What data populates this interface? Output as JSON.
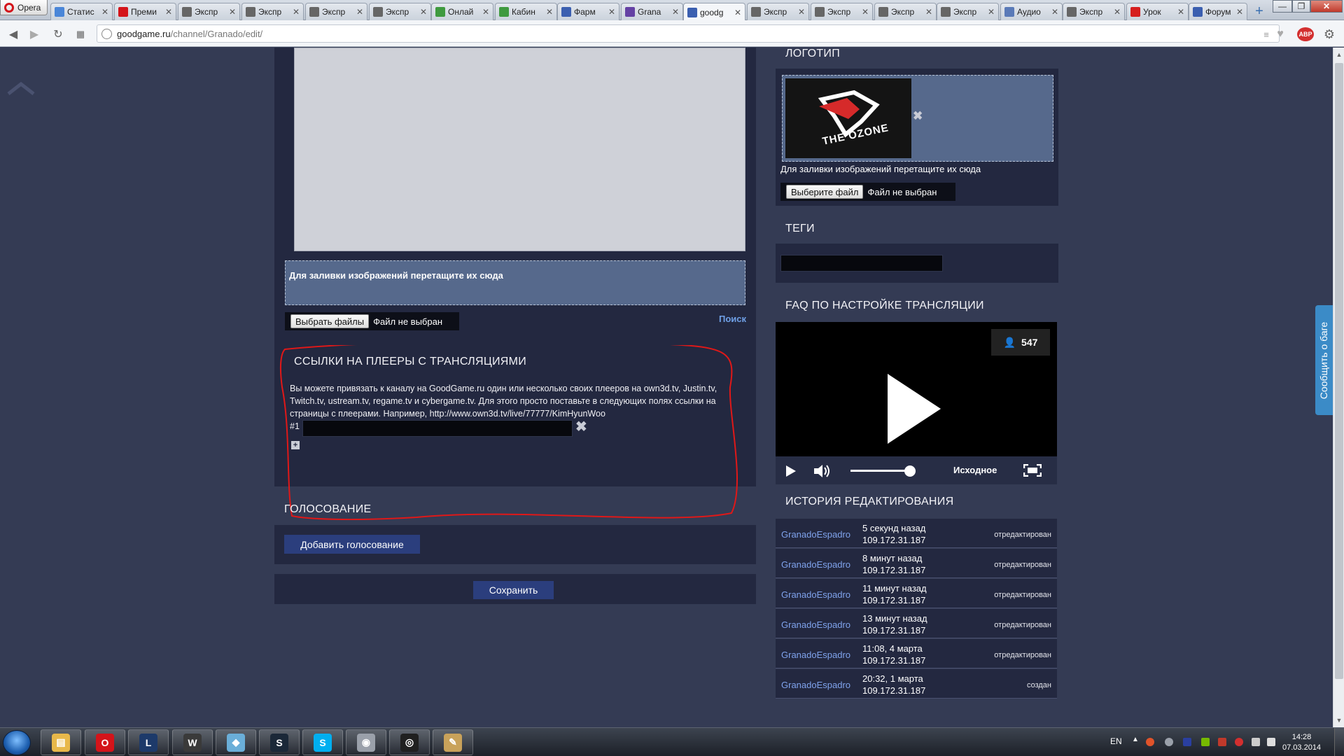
{
  "browser": {
    "menu_label": "Opera",
    "tabs": [
      {
        "label": "Статис",
        "icon": "cloud-icon",
        "color": "#4a86d8"
      },
      {
        "label": "Преми",
        "icon": "opera-icon",
        "color": "#d4141a"
      },
      {
        "label": "Экспр",
        "icon": "grid-icon",
        "color": "#666666"
      },
      {
        "label": "Экспр",
        "icon": "grid-icon",
        "color": "#666666"
      },
      {
        "label": "Экспр",
        "icon": "grid-icon",
        "color": "#666666"
      },
      {
        "label": "Экспр",
        "icon": "grid-icon",
        "color": "#666666"
      },
      {
        "label": "Онлай",
        "icon": "leaf-icon",
        "color": "#3f9a3f"
      },
      {
        "label": "Кабин",
        "icon": "leaf-icon",
        "color": "#3f9a3f"
      },
      {
        "label": "Фарм",
        "icon": "goodgame-icon",
        "color": "#3b5fb0"
      },
      {
        "label": "Granа",
        "icon": "twitch-icon",
        "color": "#6441a4"
      },
      {
        "label": "goodg",
        "icon": "goodgame-icon",
        "color": "#3b5fb0"
      },
      {
        "label": "Экспр",
        "icon": "grid-icon",
        "color": "#666666"
      },
      {
        "label": "Экспр",
        "icon": "grid-icon",
        "color": "#666666"
      },
      {
        "label": "Экспр",
        "icon": "grid-icon",
        "color": "#666666"
      },
      {
        "label": "Экспр",
        "icon": "grid-icon",
        "color": "#666666"
      },
      {
        "label": "Аудио",
        "icon": "audio-icon",
        "color": "#5a7ab8"
      },
      {
        "label": "Экспр",
        "icon": "grid-icon",
        "color": "#666666"
      },
      {
        "label": "Урок",
        "icon": "youtube-icon",
        "color": "#d61f1f"
      },
      {
        "label": "Форум",
        "icon": "goodgame-icon",
        "color": "#3b5fb0"
      }
    ],
    "address": {
      "host": "goodgame.ru",
      "path": "/channel/Granado/edit/"
    }
  },
  "editor": {
    "dropzone_text": "Для заливки изображений перетащите их сюда",
    "file_button": "Выбрать файлы",
    "file_status": "Файл не выбран",
    "search_link": "Поиск"
  },
  "players": {
    "title": "ССЫЛКИ НА ПЛЕЕРЫ С ТРАНСЛЯЦИЯМИ",
    "description_1": "Вы можете привязать к каналу на GoodGame.ru один или несколько своих плееров на own3d.tv, Justin.tv,",
    "description_2": "Twitch.tv, ustream.tv, regame.tv и cybergame.tv. Для этого просто поставьте в следующих полях ссылки на",
    "description_3": "страницы с плеерами. Например, http://www.own3d.tv/live/77777/KimHyunWoo",
    "row_label": "#1",
    "row_value": ""
  },
  "voting": {
    "title": "ГОЛОСОВАНИЕ",
    "add_button": "Добавить голосование"
  },
  "save_button": "Сохранить",
  "logo": {
    "title": "ЛОГОТИП",
    "image_text": "THE OZONE",
    "dropzone_text": "Для заливки изображений перетащите их сюда",
    "file_button": "Выберите файл",
    "file_status": "Файл не выбран"
  },
  "tags": {
    "title": "ТЕГИ",
    "value": ""
  },
  "faq": {
    "title": "FAQ ПО НАСТРОЙКЕ ТРАНСЛЯЦИИ",
    "viewers": "547",
    "quality": "Исходное",
    "volume_level": 0.85
  },
  "history": {
    "title": "ИСТОРИЯ РЕДАКТИРОВАНИЯ",
    "rows": [
      {
        "user": "GranadoEspadro",
        "time": "5 секунд назад",
        "ip": "109.172.31.187",
        "action": "отредактирован"
      },
      {
        "user": "GranadoEspadro",
        "time": "8 минут назад",
        "ip": "109.172.31.187",
        "action": "отредактирован"
      },
      {
        "user": "GranadoEspadro",
        "time": "11 минут назад",
        "ip": "109.172.31.187",
        "action": "отредактирован"
      },
      {
        "user": "GranadoEspadro",
        "time": "13 минут назад",
        "ip": "109.172.31.187",
        "action": "отредактирован"
      },
      {
        "user": "GranadoEspadro",
        "time": "11:08, 4 марта",
        "ip": "109.172.31.187",
        "action": "отредактирован"
      },
      {
        "user": "GranadoEspadro",
        "time": "20:32, 1 марта",
        "ip": "109.172.31.187",
        "action": "создан"
      }
    ]
  },
  "bug_report": "Сообщить о баге",
  "taskbar": {
    "apps": [
      {
        "name": "explorer-icon",
        "color": "#e8b84a"
      },
      {
        "name": "opera-icon",
        "color": "#d4141a"
      },
      {
        "name": "league-icon",
        "color": "#1d3a6a"
      },
      {
        "name": "world-of-tanks-icon",
        "color": "#3a3a3a"
      },
      {
        "name": "blue-app-icon",
        "color": "#6aaed8"
      },
      {
        "name": "steam-icon",
        "color": "#1b2838"
      },
      {
        "name": "skype-icon",
        "color": "#00aff0"
      },
      {
        "name": "disk-icon",
        "color": "#9aa0aa"
      },
      {
        "name": "obs-icon",
        "color": "#202020"
      },
      {
        "name": "paint-icon",
        "color": "#c9a25a"
      }
    ],
    "language": "EN",
    "time": "14:28",
    "date": "07.03.2014"
  }
}
